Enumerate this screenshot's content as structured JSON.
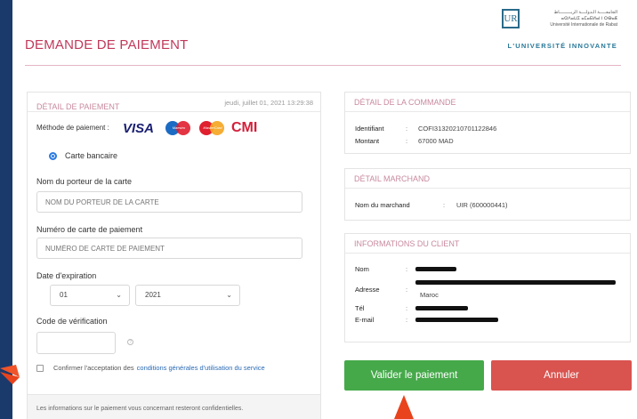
{
  "header": {
    "title": "DEMANDE DE PAIEMENT",
    "logo_mark": "UR",
    "logo_lines": [
      "الجامعـــــة الـدولــــة الربـــــــــاط",
      "ⴰⵙⴷⴰⵡⵉ ⴰⵎⴰⴹⵍⴰⵏ ⵏ ⵔⴱⴰⵟ",
      "Université Internationale de Rabat"
    ],
    "logo_tagline": "L'UNIVERSITÉ INNOVANTE",
    "accent_color": "#c0395a"
  },
  "payment": {
    "title": "DÉTAIL DE PAIEMENT",
    "date": "jeudi, juillet 01, 2021 13:29:38",
    "method_label": "Méthode de paiement :",
    "brands": {
      "visa": "VISA",
      "maestro": "Maestro",
      "mastercard": "MasterCard",
      "cmi": "CMI"
    },
    "radio_label": "Carte bancaire",
    "holder_label": "Nom du porteur de la carte",
    "holder_placeholder": "NOM DU PORTEUR DE LA CARTE",
    "card_label": "Numéro de carte de paiement",
    "card_placeholder": "NUMÉRO DE CARTE DE PAIEMENT",
    "expiry_label": "Date d'expiration",
    "expiry_month": "01",
    "expiry_year": "2021",
    "cvv_label": "Code de vérification",
    "help_glyph": "?",
    "terms_text": "Confirmer l'acceptation des",
    "terms_link": "conditions générales d'utilisation du service",
    "footer_note": "Les informations sur le paiement vous concernant resteront confidentielles."
  },
  "order": {
    "title": "DÉTAIL DE LA COMMANDE",
    "id_label": "Identifiant",
    "id_value": "COFI31320210701122846",
    "amount_label": "Montant",
    "amount_value": "67000 MAD"
  },
  "merchant": {
    "title": "DÉTAIL MARCHAND",
    "name_label": "Nom du marchand",
    "name_value": "UIR (600000441)"
  },
  "client": {
    "title": "INFORMATIONS DU CLIENT",
    "name_label": "Nom",
    "address_label": "Adresse",
    "address_country": "Maroc",
    "phone_label": "Tél",
    "email_label": "E-mail"
  },
  "actions": {
    "submit": "Valider le paiement",
    "cancel": "Annuler",
    "submit_color": "#45a94a",
    "cancel_color": "#d9534f"
  },
  "colon": ":",
  "chevron": "⌄"
}
